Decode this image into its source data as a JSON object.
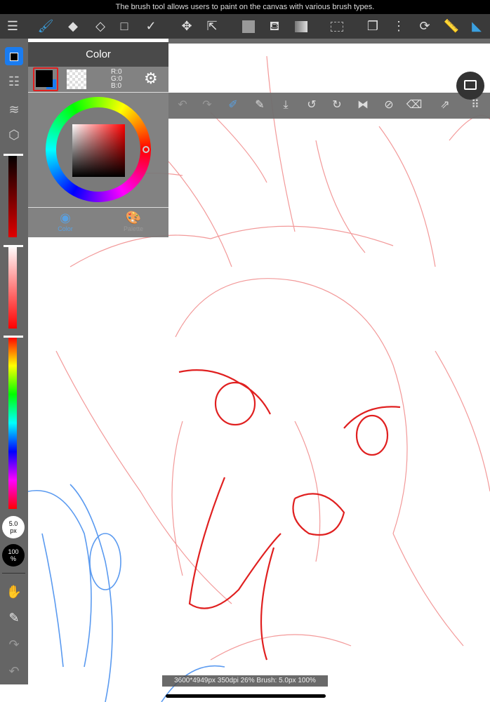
{
  "caption": "The brush tool allows users to paint on the canvas with various brush types.",
  "toolbar": {
    "tools": [
      "menu-icon",
      "brush-icon",
      "eraser-icon",
      "lasso-eraser-icon",
      "rectangle-icon",
      "dot-line-icon",
      "move-icon",
      "transform-icon",
      "fill-color-icon",
      "bucket-icon",
      "gradient-icon",
      "selection-icon",
      "layers-pages-icon",
      "select-menu-icon",
      "rotate-icon",
      "ruler-icon",
      "highlight-brush-icon"
    ]
  },
  "color_panel": {
    "title": "Color",
    "r": "R:0",
    "g": "G:0",
    "b": "B:0",
    "tab_color": "Color",
    "tab_palette": "Palette",
    "primary": "#000000",
    "secondary": "#1a7cf0"
  },
  "sidebar": {
    "brush_size": "5.0",
    "brush_unit": "px",
    "opacity": "100",
    "opacity_unit": "%"
  },
  "status": "3600*4949px 350dpi 26% Brush: 5.0px 100%"
}
